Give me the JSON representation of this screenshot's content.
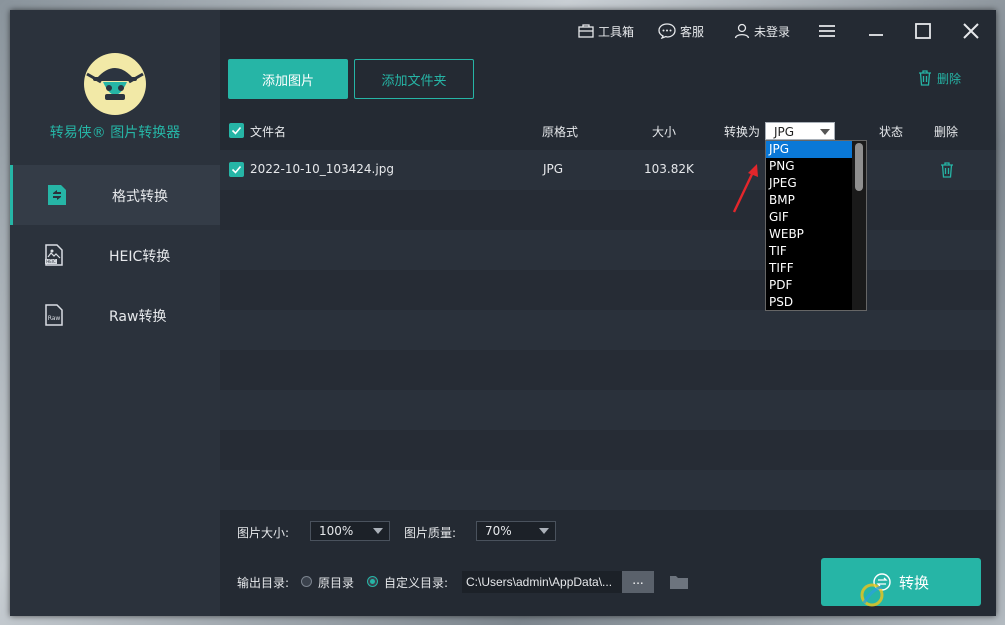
{
  "app": {
    "title": "转易侠® 图片转换器"
  },
  "titlebar": {
    "toolbox": "工具箱",
    "service": "客服",
    "login": "未登录"
  },
  "sidebar": {
    "items": [
      {
        "label": "格式转换",
        "icon": "format-convert-icon",
        "active": true
      },
      {
        "label": "HEIC转换",
        "icon": "heic-file-icon",
        "active": false
      },
      {
        "label": "Raw转换",
        "icon": "raw-file-icon",
        "active": false
      }
    ],
    "raw_icon_text": "Raw",
    "heic_icon_text": "HEIC"
  },
  "toolbar": {
    "add_image": "添加图片",
    "add_folder": "添加文件夹",
    "delete": "删除"
  },
  "table": {
    "headers": {
      "filename": "文件名",
      "format": "原格式",
      "size": "大小",
      "convert_to": "转换为",
      "status": "状态",
      "delete": "删除"
    },
    "rows": [
      {
        "checked": true,
        "filename": "2022-10-10_103424.jpg",
        "format": "JPG",
        "size": "103.82K"
      }
    ]
  },
  "convert_select": {
    "value": "JPG",
    "options": [
      "JPG",
      "PNG",
      "JPEG",
      "BMP",
      "GIF",
      "WEBP",
      "TIF",
      "TIFF",
      "PDF",
      "PSD"
    ],
    "selected_index": 0
  },
  "settings": {
    "image_size_label": "图片大小:",
    "image_size_value": "100%",
    "quality_label": "图片质量:",
    "quality_value": "70%",
    "output_label": "输出目录:",
    "option_original": "原目录",
    "option_custom": "自定义目录:",
    "selected_output": "custom",
    "path": "C:\\Users\\admin\\AppData\\...",
    "browse": "..."
  },
  "actions": {
    "convert": "转换"
  },
  "colors": {
    "accent": "#26b5a6",
    "highlight": "#0a78d7",
    "bg": "#242a33",
    "sidebar": "#2b323c"
  }
}
